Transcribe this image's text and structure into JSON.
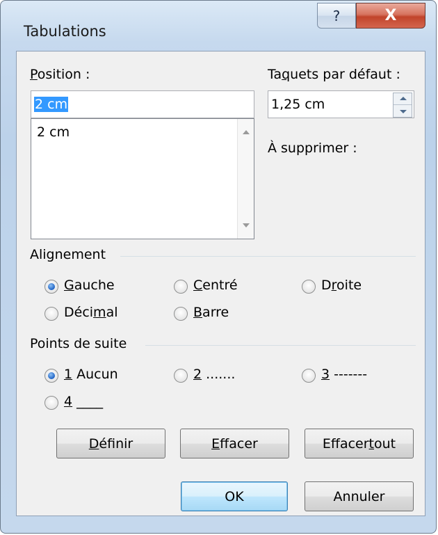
{
  "window": {
    "title": "Tabulations",
    "help_glyph": "?",
    "close_glyph": "X"
  },
  "position": {
    "label_prefix": "",
    "label_underlined": "P",
    "label_rest": "osition :",
    "value": "2 cm",
    "list": [
      "2 cm"
    ]
  },
  "default_tabs": {
    "label_prefix": "Ta",
    "label_underlined": "q",
    "label_rest": "uets par défaut :",
    "value": "1,25 cm"
  },
  "to_clear": {
    "label": "À supprimer :"
  },
  "alignment": {
    "group_label": "Alignement",
    "options": [
      {
        "pre": "",
        "u": "G",
        "post": "auche",
        "checked": true
      },
      {
        "pre": "",
        "u": "C",
        "post": "entré",
        "checked": false
      },
      {
        "pre": "D",
        "u": "r",
        "post": "oite",
        "checked": false
      },
      {
        "pre": "Déci",
        "u": "m",
        "post": "al",
        "checked": false
      },
      {
        "pre": "",
        "u": "B",
        "post": "arre",
        "checked": false
      }
    ]
  },
  "leader": {
    "group_label": "Points de suite",
    "options": [
      {
        "u": "1",
        "post": " Aucun",
        "checked": true
      },
      {
        "u": "2",
        "post": " .......",
        "checked": false
      },
      {
        "u": "3",
        "post": " -------",
        "checked": false
      },
      {
        "u": "4",
        "post": " ____",
        "checked": false
      }
    ]
  },
  "buttons": {
    "set": {
      "pre": "",
      "u": "D",
      "post": "éfinir"
    },
    "clear": {
      "pre": "",
      "u": "E",
      "post": "ffacer"
    },
    "clear_all": {
      "pre": "Effacer ",
      "u": "t",
      "post": "out"
    },
    "ok": "OK",
    "cancel": "Annuler"
  }
}
